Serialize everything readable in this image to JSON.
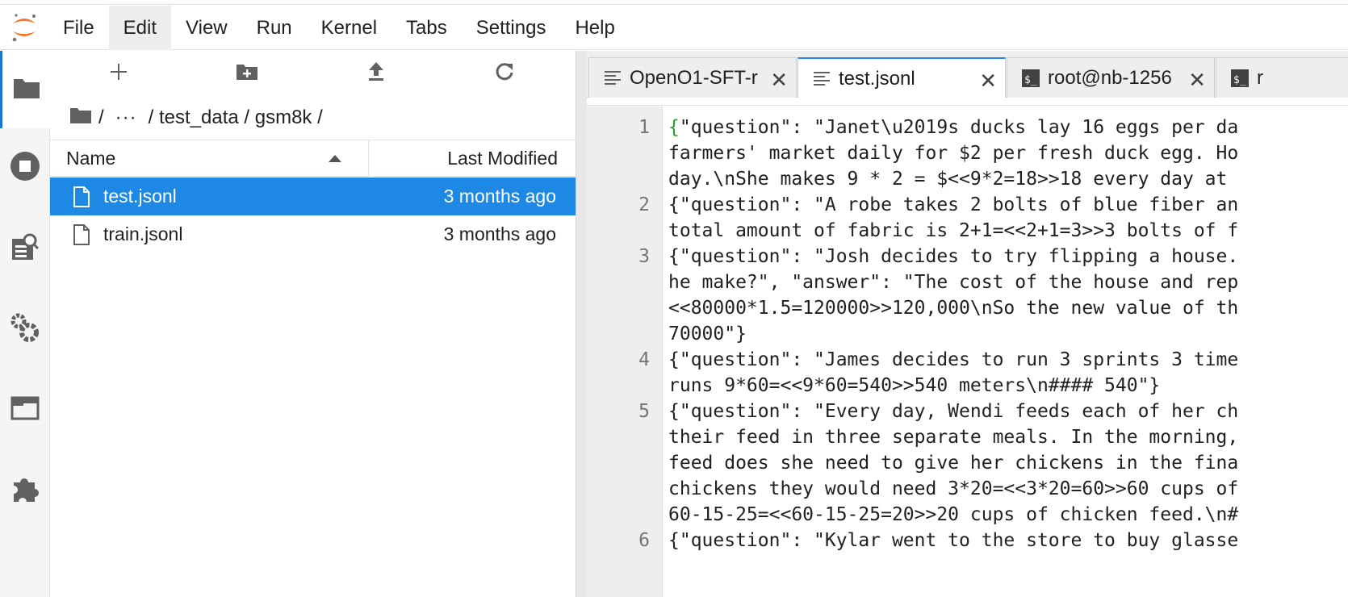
{
  "menu": {
    "items": [
      "File",
      "Edit",
      "View",
      "Run",
      "Kernel",
      "Tabs",
      "Settings",
      "Help"
    ],
    "active": "Edit"
  },
  "sidebar": {
    "tabs": [
      "folder-icon",
      "running-icon",
      "commands-icon",
      "property-inspector-icon",
      "tabs-icon",
      "extension-icon"
    ]
  },
  "filebrowser": {
    "toolbar": [
      "new-launcher-icon",
      "new-folder-icon",
      "upload-icon",
      "refresh-icon"
    ],
    "breadcrumb": {
      "root": "/",
      "ellipsis": "···",
      "path": "/ test_data / gsm8k /"
    },
    "columns": {
      "name": "Name",
      "modified": "Last Modified"
    },
    "files": [
      {
        "name": "test.jsonl",
        "modified": "3 months ago",
        "selected": true
      },
      {
        "name": "train.jsonl",
        "modified": "3 months ago",
        "selected": false
      }
    ]
  },
  "tabs": [
    {
      "label": "OpenO1-SFT-r",
      "type": "text-file"
    },
    {
      "label": "test.jsonl",
      "type": "text-file",
      "current": true
    },
    {
      "label": "root@nb-1256",
      "type": "terminal"
    },
    {
      "label": "r",
      "type": "terminal"
    }
  ],
  "editor": {
    "lines": [
      {
        "num": "1",
        "text": [
          "{\"question\": \"Janet\\u2019s ducks lay 16 eggs per da",
          "farmers' market daily for $2 per fresh duck egg. Ho",
          "day.\\nShe makes 9 * 2 = $<<9*2=18>>18 every day at"
        ]
      },
      {
        "num": "2",
        "text": [
          "{\"question\": \"A robe takes 2 bolts of blue fiber an",
          "total amount of fabric is 2+1=<<2+1=3>>3 bolts of f"
        ]
      },
      {
        "num": "3",
        "text": [
          "{\"question\": \"Josh decides to try flipping a house.",
          "he make?\", \"answer\": \"The cost of the house and rep",
          "<<80000*1.5=120000>>120,000\\nSo the new value of th",
          "70000\"}"
        ]
      },
      {
        "num": "4",
        "text": [
          "{\"question\": \"James decides to run 3 sprints 3 time",
          "runs 9*60=<<9*60=540>>540 meters\\n#### 540\"}"
        ]
      },
      {
        "num": "5",
        "text": [
          "{\"question\": \"Every day, Wendi feeds each of her ch",
          "their feed in three separate meals. In the morning,",
          "feed does she need to give her chickens in the fina",
          "chickens they would need 3*20=<<3*20=60>>60 cups of",
          "60-15-25=<<60-15-25=20>>20 cups of chicken feed.\\n#"
        ]
      },
      {
        "num": "6",
        "text": [
          "{\"question\": \"Kylar went to the store to buy glasse"
        ]
      }
    ]
  }
}
